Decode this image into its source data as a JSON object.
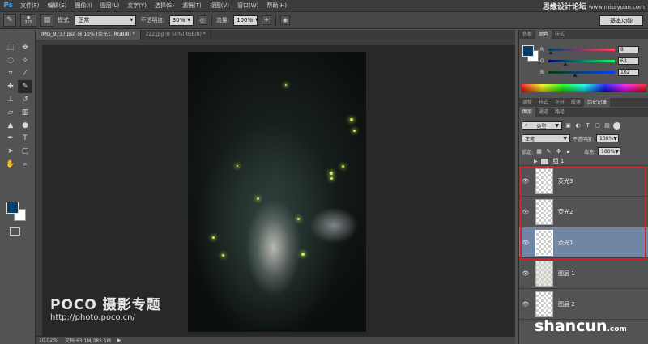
{
  "app": {
    "logo": "Ps"
  },
  "menu": [
    "文件(F)",
    "编辑(E)",
    "图像(I)",
    "图层(L)",
    "文字(Y)",
    "选择(S)",
    "滤镜(T)",
    "视图(V)",
    "窗口(W)",
    "帮助(H)"
  ],
  "watermark_top": {
    "text": "思缘设计论坛",
    "url": "www.missyuan.com"
  },
  "options": {
    "brush_size": "325",
    "mode_label": "模式:",
    "mode_value": "正常",
    "opacity_label": "不透明度:",
    "opacity_value": "30%",
    "flow_label": "流量:",
    "flow_value": "100%",
    "workspace": "基本功能"
  },
  "doc_tabs": [
    {
      "label": "IMG_9737.psd @ 10% (荧光1, RGB/8) *",
      "active": true
    },
    {
      "label": "222.jpg @ 50%(RGB/8) *",
      "active": false
    }
  ],
  "status": {
    "zoom": "10.02%",
    "doc_info": "文档:63.1M/385.1M"
  },
  "watermark_poco": {
    "title": "POCO 摄影专题",
    "url": "http://photo.poco.cn/"
  },
  "watermark_shancun": {
    "main": "shancun",
    "tld": ".com"
  },
  "color_panel": {
    "tabs": [
      "色板",
      "颜色",
      "样式"
    ],
    "active_tab": "颜色",
    "r": "8",
    "g": "63",
    "b": "102",
    "r_frac": 0.03,
    "g_frac": 0.25,
    "b_frac": 0.4,
    "fg_color": "#083f66",
    "bg_color": "#ffffff"
  },
  "adjust_tabs": [
    "调整",
    "样式",
    "字符",
    "段落",
    "历史记录"
  ],
  "layer_tabs": [
    "图层",
    "通道",
    "路径"
  ],
  "layers_panel": {
    "filter": "类型",
    "blend_mode": "正常",
    "opacity_label": "不透明度:",
    "opacity": "100%",
    "lock_label": "锁定:",
    "fill_label": "填充:",
    "fill": "100%"
  },
  "layers": [
    {
      "name": "组 1",
      "type": "group"
    },
    {
      "name": "荧光3",
      "type": "layer"
    },
    {
      "name": "荧光2",
      "type": "layer"
    },
    {
      "name": "荧光1",
      "type": "layer",
      "selected": true
    },
    {
      "name": "图层 1",
      "type": "layer"
    },
    {
      "name": "图层 2",
      "type": "layer"
    }
  ]
}
